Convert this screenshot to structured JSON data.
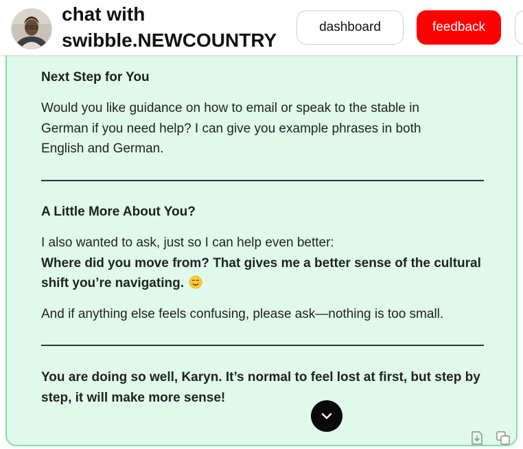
{
  "header": {
    "title": "chat with swibble.NEWCOUNTRY",
    "dashboard_label": "dashboard",
    "feedback_label": "feedback"
  },
  "message": {
    "section1": {
      "heading": "Next Step for You",
      "body": "Would you like guidance on how to email or speak to the stable in German if you need help? I can give you example phrases in both English and German."
    },
    "section2": {
      "heading": "A Little More About You?",
      "intro": "I also wanted to ask, just so I can help even better:",
      "question": "Where did you move from? That gives me a better sense of the cultural shift you’re navigating.",
      "emoji": "smiling-face-emoji",
      "followup": "And if anything else feels confusing, please ask—nothing is too small."
    },
    "closing": "You are doing so well, Karyn. It’s normal to feel lost at first, but step by step, it will make more sense!"
  },
  "colors": {
    "card_background": "#dffaea",
    "card_border": "#7fdfa6",
    "feedback_button": "#ff0000",
    "divider": "#2b3545"
  },
  "icons": {
    "scroll": "chevron-down-icon",
    "download": "download-icon",
    "copy": "copy-icon"
  }
}
